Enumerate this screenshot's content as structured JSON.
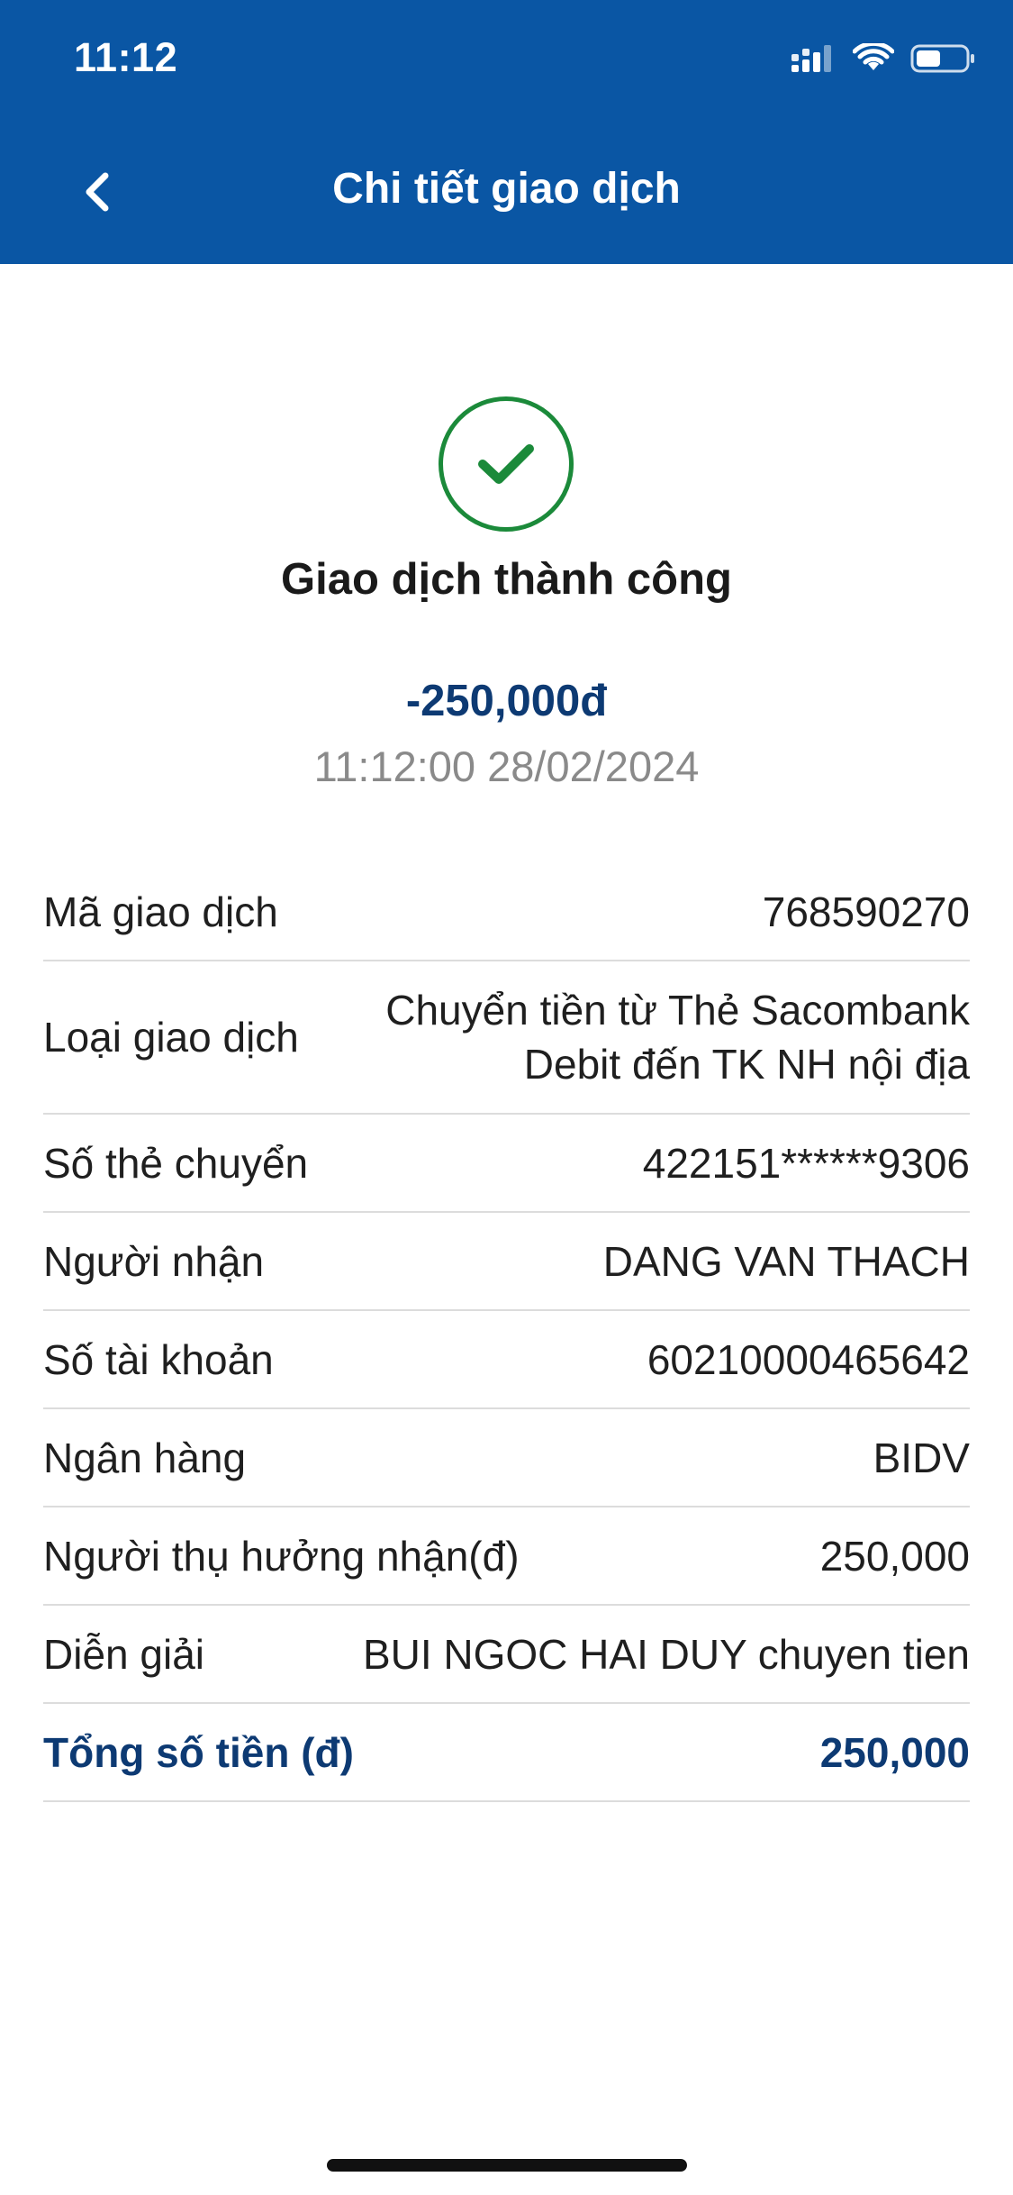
{
  "status_bar": {
    "time": "11:12",
    "icons": [
      "signal-icon",
      "wifi-icon",
      "battery-icon"
    ]
  },
  "nav": {
    "back_icon": "chevron-left-icon",
    "title": "Chi tiết giao dịch"
  },
  "result": {
    "icon": "check-icon",
    "title": "Giao dịch thành công",
    "amount": "-250,000đ",
    "datetime": "11:12:00 28/02/2024"
  },
  "details": [
    {
      "label": "Mã giao dịch",
      "value": "768590270"
    },
    {
      "label": "Loại giao dịch",
      "value": "Chuyển tiền từ Thẻ Sacombank\nDebit đến TK NH nội địa"
    },
    {
      "label": "Số thẻ chuyển",
      "value": "422151******9306"
    },
    {
      "label": "Người nhận",
      "value": "DANG VAN THACH"
    },
    {
      "label": "Số tài khoản",
      "value": "60210000465642"
    },
    {
      "label": "Ngân hàng",
      "value": "BIDV"
    },
    {
      "label": "Người thụ hưởng nhận(đ)",
      "value": "250,000"
    },
    {
      "label": "Diễn giải",
      "value": "BUI NGOC HAI DUY chuyen tien"
    }
  ],
  "total": {
    "label": "Tổng số tiền (đ)",
    "value": "250,000"
  },
  "colors": {
    "header_bg": "#0a56a4",
    "success_green": "#1b8a3a",
    "amount_navy": "#0d3a73",
    "muted_gray": "#8a8a8a"
  }
}
